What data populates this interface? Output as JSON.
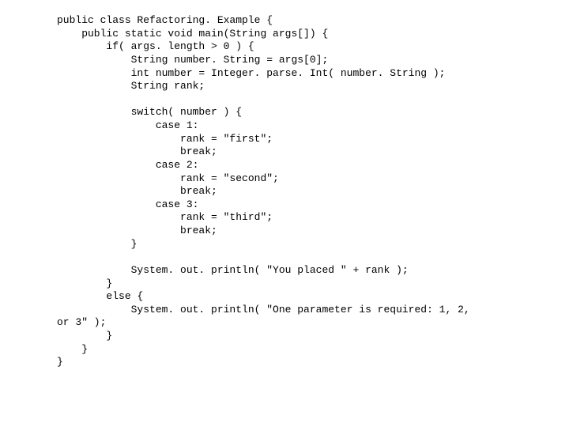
{
  "code": {
    "lines": [
      "public class Refactoring. Example {",
      "    public static void main(String args[]) {",
      "        if( args. length > 0 ) {",
      "            String number. String = args[0];",
      "            int number = Integer. parse. Int( number. String );",
      "            String rank;",
      "",
      "            switch( number ) {",
      "                case 1:",
      "                    rank = \"first\";",
      "                    break;",
      "                case 2:",
      "                    rank = \"second\";",
      "                    break;",
      "                case 3:",
      "                    rank = \"third\";",
      "                    break;",
      "            }",
      "",
      "            System. out. println( \"You placed \" + rank );",
      "        }",
      "        else {",
      "            System. out. println( \"One parameter is required: 1, 2,",
      "or 3\" );",
      "        }",
      "    }",
      "}"
    ]
  }
}
